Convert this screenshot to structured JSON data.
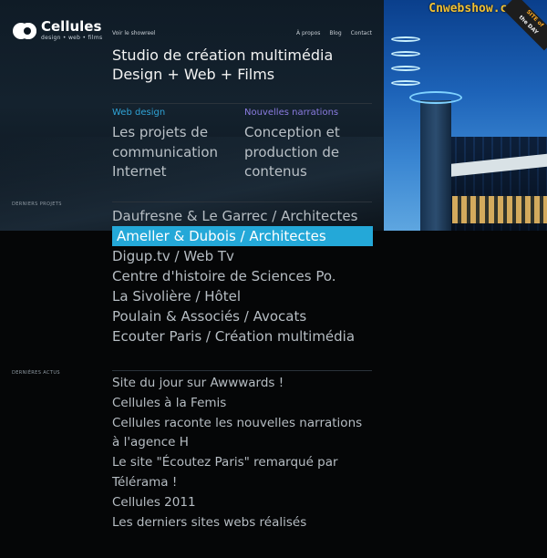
{
  "brand": {
    "name": "Cellules",
    "tagline": "design • web • films"
  },
  "nav": {
    "showreel": "Voir le showreel",
    "links": [
      "À propos",
      "Blog",
      "Contact"
    ]
  },
  "header": {
    "line1": "Studio de création multimédia",
    "line2": "Design + Web + Films"
  },
  "columns": [
    {
      "title": "Web design",
      "title_color": "#2fa3d6",
      "body": [
        "Les projets de",
        "communication",
        "Internet"
      ]
    },
    {
      "title": "Nouvelles narrations",
      "title_color": "#8a7be0",
      "body": [
        "Conception et",
        "production de",
        "contenus"
      ]
    }
  ],
  "sections": {
    "projects_label": "DERNIERS PROJETS",
    "news_label": "DERNIÈRES ACTUS"
  },
  "projects": [
    "Daufresne & Le Garrec / Architectes",
    "Ameller & Dubois / Architectes",
    "Digup.tv / Web Tv",
    "Centre d'histoire de Sciences Po.",
    "La Sivolière / Hôtel",
    "Poulain & Associés / Avocats",
    "Ecouter Paris / Création multimédia"
  ],
  "projects_active_index": 1,
  "news": [
    "Site du jour sur Awwwards !",
    "Cellules à la Femis",
    "Cellules raconte les nouvelles narrations",
    "à l'agence H",
    "Le site \"Écoutez Paris\" remarqué par",
    "Télérama !",
    "Cellules 2011",
    "Les derniers sites webs réalisés"
  ],
  "watermark": "Cnwebshow.com",
  "badge": {
    "line1": "SITE of",
    "line2": "the DAY"
  },
  "colors": {
    "accent": "#24a8d8",
    "background": "#050607",
    "watermark": "#f3c233"
  }
}
